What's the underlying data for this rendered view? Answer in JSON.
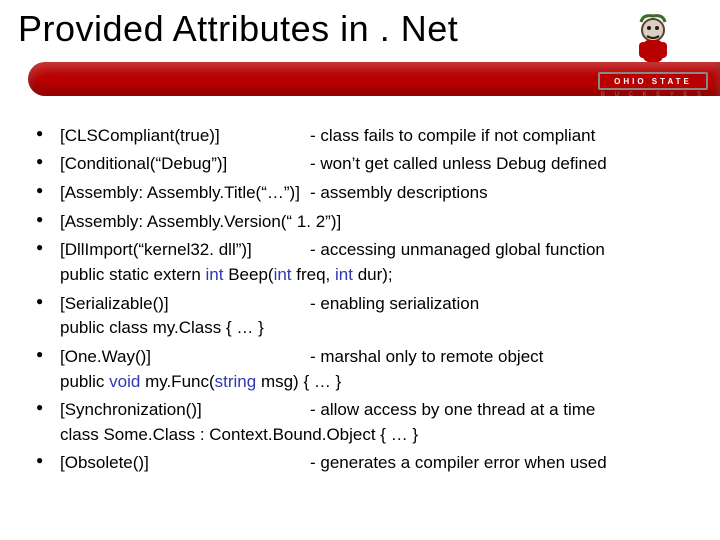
{
  "title": "Provided Attributes in . Net",
  "logo": {
    "band": "OHIO STATE",
    "sub": "B U C K E Y E S"
  },
  "bullets": [
    {
      "attr": "[CLSCompliant(true)]",
      "desc": "- class fails to compile if not compliant"
    },
    {
      "attr": "[Conditional(“Debug”)]",
      "desc": "- won’t get called unless Debug defined"
    },
    {
      "attr": "[Assembly: Assembly.Title(“…”)]",
      "desc": "- assembly descriptions"
    },
    {
      "attr": "[Assembly: Assembly.Version(“ 1. 2”)]",
      "desc": ""
    },
    {
      "attr": "[DllImport(“kernel32. dll”)]",
      "desc": "- accessing unmanaged global function",
      "code_pre": "public static extern ",
      "code_kw1": "int ",
      "code_mid1": "Beep(",
      "code_kw2": "int ",
      "code_mid2": "freq, ",
      "code_kw3": "int ",
      "code_mid3": "dur);"
    },
    {
      "attr": "[Serializable()]",
      "desc": "- enabling serialization",
      "code_plain": "public class my.Class { … }"
    },
    {
      "attr": "[One.Way()]",
      "desc": "- marshal only to remote object",
      "code_pre": "public ",
      "code_kw1": "void ",
      "code_mid1": "my.Func(",
      "code_kw2": "string ",
      "code_mid2": "msg) { … }"
    },
    {
      "attr": "[Synchronization()]",
      "desc": "- allow access by one thread at a time",
      "code_plain": "class Some.Class : Context.Bound.Object { … }"
    },
    {
      "attr": "[Obsolete()]",
      "desc": "- generates a compiler error when used"
    }
  ]
}
